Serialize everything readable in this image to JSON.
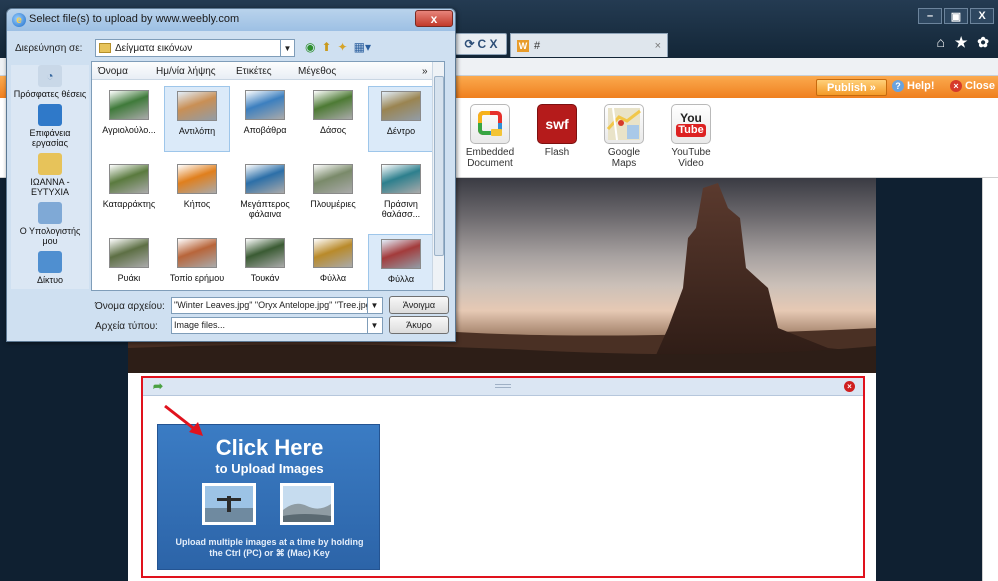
{
  "browser": {
    "window_controls": [
      "–",
      "▣",
      "X"
    ],
    "address_tail": "C X",
    "tab_title": "#",
    "tab_close": "×",
    "toolbar_icons": "⌂ ★ ✿"
  },
  "weebly": {
    "publish_label": "Publish »",
    "help_label": "Help!",
    "close_label": "Close",
    "elements": [
      {
        "label": "Embedded\nDocument"
      },
      {
        "label": "Flash",
        "icon_text": "swf"
      },
      {
        "label": "Google\nMaps"
      },
      {
        "label": "YouTube\nVideo",
        "icon_text_top": "You",
        "icon_text_bottom": "Tube"
      }
    ]
  },
  "upload_panel": {
    "title": "Click Here",
    "subtitle": "to Upload Images",
    "description": "Upload multiple images at a time by holding the Ctrl (PC) or ⌘ (Mac) Key"
  },
  "dialog": {
    "title": "Select file(s) to upload by www.weebly.com",
    "close_label": "x",
    "look_in_label": "Διερεύνηση σε:",
    "look_in_value": "Δείγματα εικόνων",
    "places": [
      {
        "label": "Πρόσφατες θέσεις"
      },
      {
        "label": "Επιφάνεια εργασίας"
      },
      {
        "label": "IΩANNA - ΕΥΤΥΧΙΑ"
      },
      {
        "label": "Ο Υπολογιστής μου"
      },
      {
        "label": "Δίκτυο"
      }
    ],
    "columns": [
      "Όνομα",
      "Ημ/νία λήψης",
      "Ετικέτες",
      "Μέγεθος"
    ],
    "more_columns": "»",
    "files": [
      {
        "name": "Αγριολούλο...",
        "selected": false,
        "color": "#3f7a3a"
      },
      {
        "name": "Αντιλόπη",
        "selected": true,
        "color": "#c98f55"
      },
      {
        "name": "Αποβάθρα",
        "selected": false,
        "color": "#3c7fbf"
      },
      {
        "name": "Δάσος",
        "selected": false,
        "color": "#4d7a34"
      },
      {
        "name": "Δέντρο",
        "selected": true,
        "color": "#9a8451"
      },
      {
        "name": "Καταρράκτης",
        "selected": false,
        "color": "#5a7a3e"
      },
      {
        "name": "Κήπος",
        "selected": false,
        "color": "#e07f1d"
      },
      {
        "name": "Μεγάπτερος φάλαινα",
        "selected": false,
        "color": "#2c6fa8"
      },
      {
        "name": "Πλουμέριες",
        "selected": false,
        "color": "#7a8a6a"
      },
      {
        "name": "Πράσινη θαλάσσ...",
        "selected": false,
        "color": "#2d7f8d"
      },
      {
        "name": "Ρυάκι",
        "selected": false,
        "color": "#5d6f44"
      },
      {
        "name": "Τοπίο ερήμου",
        "selected": false,
        "color": "#b8653a"
      },
      {
        "name": "Τουκάν",
        "selected": false,
        "color": "#3a5b33"
      },
      {
        "name": "Φύλλα",
        "selected": false,
        "color": "#b98a2a"
      },
      {
        "name": "Φύλλα",
        "selected": true,
        "color": "#a33b3b"
      }
    ],
    "filename_label": "Όνομα αρχείου:",
    "filename_value": "\"Winter Leaves.jpg\" \"Oryx Antelope.jpg\" \"Tree.jpg\"",
    "filetype_label": "Αρχεία τύπου:",
    "filetype_value": "Image files...",
    "open_button": "Άνοιγμα",
    "cancel_button": "Άκυρο"
  }
}
